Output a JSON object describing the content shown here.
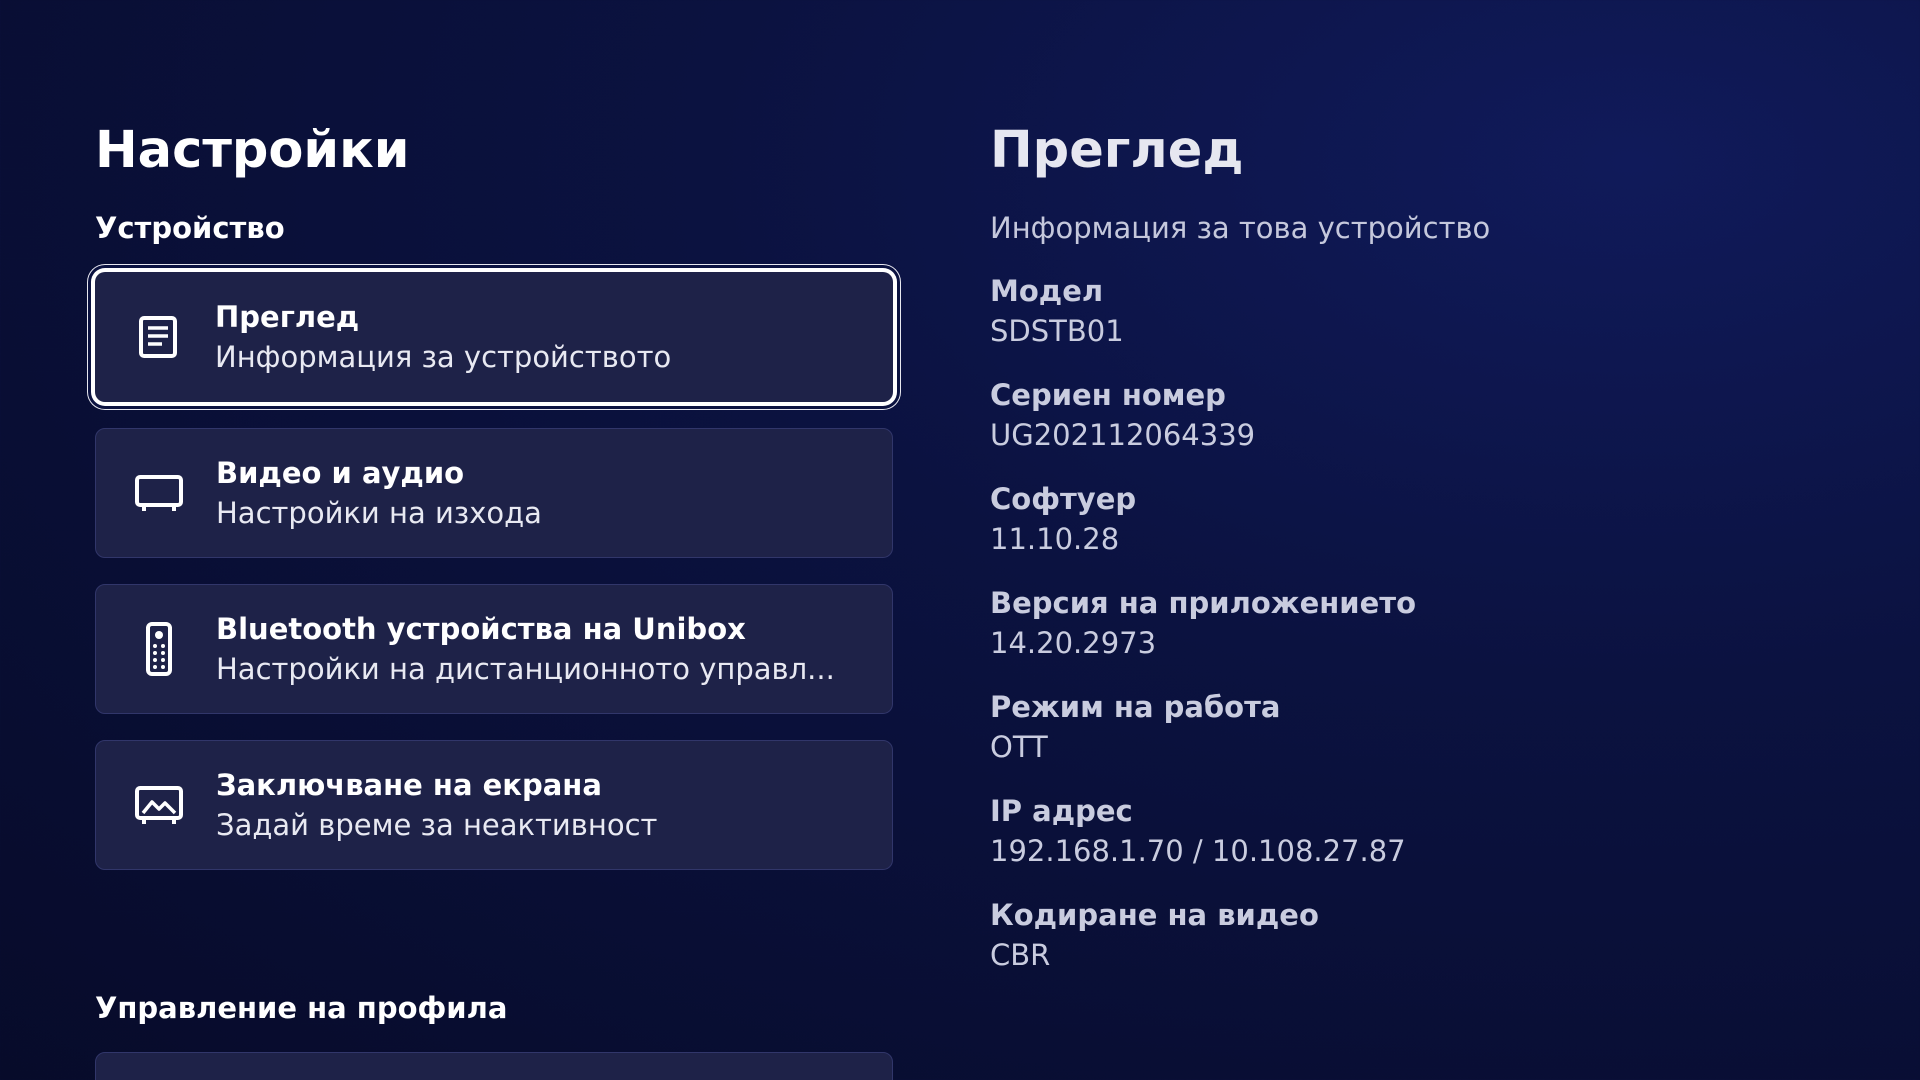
{
  "page": {
    "title": "Настройки"
  },
  "sections": {
    "device": "Устройство",
    "profile": "Управление на профила"
  },
  "menu": {
    "items": [
      {
        "title": "Преглед",
        "subtitle": "Информация за устройството",
        "icon": "document-icon",
        "selected": true
      },
      {
        "title": "Видео и аудио",
        "subtitle": "Настройки на изхода",
        "icon": "tv-icon",
        "selected": false
      },
      {
        "title": "Bluetooth устройства на Unibox",
        "subtitle": "Настройки на дистанционното управл...",
        "icon": "remote-icon",
        "selected": false
      },
      {
        "title": "Заключване на екрана",
        "subtitle": "Задай време за неактивност",
        "icon": "screen-image-icon",
        "selected": false
      }
    ]
  },
  "detail": {
    "title": "Преглед",
    "subtitle": "Информация за това устройство",
    "rows": [
      {
        "label": "Модел",
        "value": "SDSTB01"
      },
      {
        "label": "Сериен номер",
        "value": "UG202112064339"
      },
      {
        "label": "Софтуер",
        "value": "11.10.28"
      },
      {
        "label": "Версия на приложението",
        "value": "14.20.2973"
      },
      {
        "label": "Режим на работа",
        "value": "OTT"
      },
      {
        "label": "IP адрес",
        "value": "192.168.1.70 / 10.108.27.87"
      },
      {
        "label": "Кодиране на видео",
        "value": "CBR"
      }
    ]
  },
  "colors": {
    "background": "#0b1240",
    "card": "#1e2248",
    "focus_border": "#ffffff"
  }
}
